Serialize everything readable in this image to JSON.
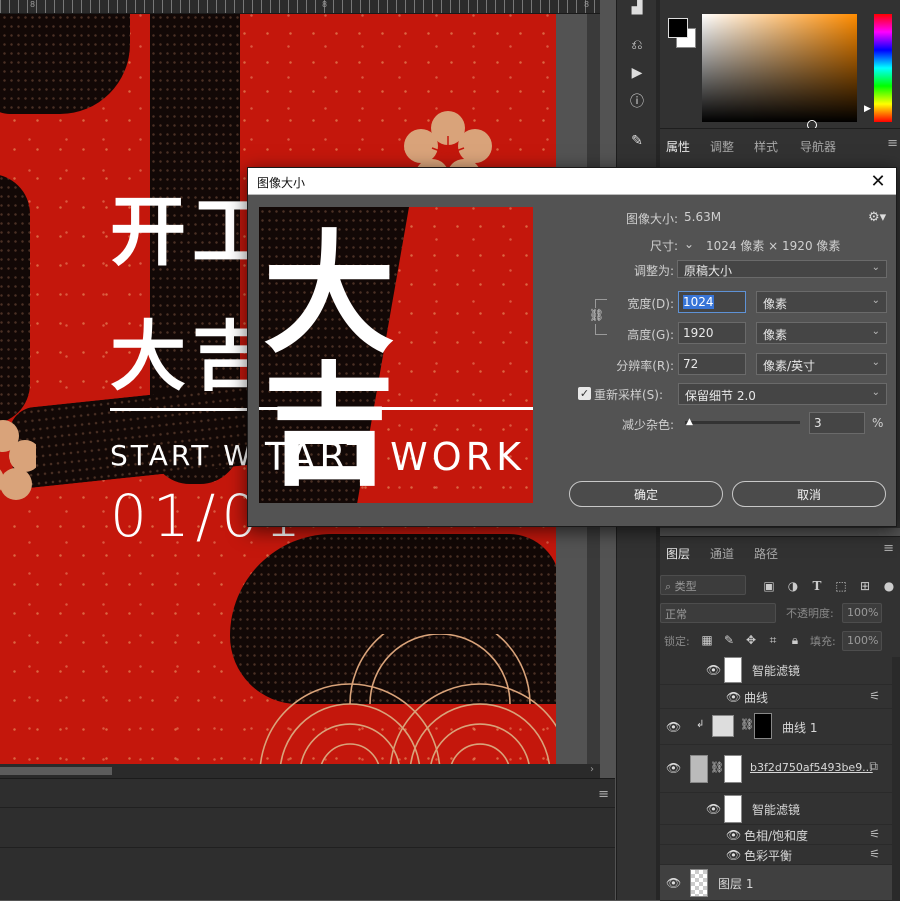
{
  "canvas": {
    "art_title_1": "开工",
    "art_title_2": "大吉",
    "art_subtitle": "START WORK",
    "art_date": "01/01",
    "ruler_numbers": [
      "8",
      "8",
      "8"
    ]
  },
  "dialog": {
    "title": "图像大小",
    "image_size_label": "图像大小:",
    "image_size_value": "5.63M",
    "dimensions_label": "尺寸:",
    "dimensions_value": "1024 像素 × 1920 像素",
    "fit_to_label": "调整为:",
    "fit_to_value": "原稿大小",
    "width_label": "宽度(D):",
    "width_value": "1024",
    "width_unit": "像素",
    "height_label": "高度(G):",
    "height_value": "1920",
    "height_unit": "像素",
    "resolution_label": "分辨率(R):",
    "resolution_value": "72",
    "resolution_unit": "像素/英寸",
    "resample_label": "重新采样(S):",
    "resample_checked": true,
    "resample_value": "保留细节 2.0",
    "noise_label": "减少杂色:",
    "noise_value": "3",
    "noise_unit": "%",
    "ok_label": "确定",
    "cancel_label": "取消",
    "preview_title": "大吉",
    "preview_subtitle": "TART WORK"
  },
  "properties_panel": {
    "tabs": [
      "属性",
      "调整",
      "样式",
      "导航器"
    ],
    "active_tab": "属性"
  },
  "layers_panel": {
    "tabs": [
      "图层",
      "通道",
      "路径"
    ],
    "active_tab": "图层",
    "filter_kind": "类型",
    "blend_mode": "正常",
    "opacity_label": "不透明度:",
    "opacity_value": "100%",
    "lock_label": "锁定:",
    "fill_label": "填充:",
    "fill_value": "100%",
    "rows": [
      {
        "name": "智能滤镜"
      },
      {
        "name": "曲线"
      },
      {
        "name": "曲线 1"
      },
      {
        "name": "b3f2d750af5493be9..."
      },
      {
        "name": "智能滤镜"
      },
      {
        "name": "色相/饱和度"
      },
      {
        "name": "色彩平衡"
      },
      {
        "name": "图层 1"
      }
    ]
  },
  "colors": {
    "accent_red": "#c4170c",
    "ink_black": "#120806",
    "flower_tan": "#d9a37a",
    "foreground_swatch": "#000000",
    "background_swatch": "#ffffff",
    "dialog_focus": "#3875d7"
  }
}
